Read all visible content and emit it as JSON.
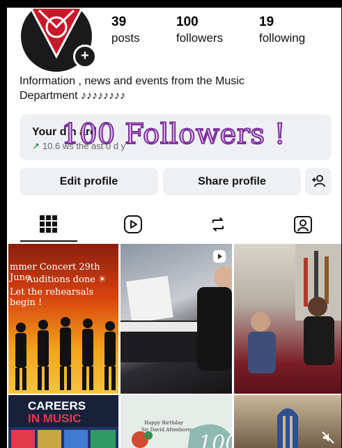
{
  "profile": {
    "stats": [
      {
        "value": "39",
        "label": "posts"
      },
      {
        "value": "100",
        "label": "followers"
      },
      {
        "value": "19",
        "label": "following"
      }
    ],
    "bio_line1": "Information , news and events from the Music",
    "bio_line2": "Department ♪♪♪♪♪♪♪♪"
  },
  "dashboard": {
    "title": "Your d    h     ard",
    "subtitle": "10.6     ws     the  ast  0 d  y"
  },
  "overlay_text": "100 Followers !",
  "buttons": {
    "edit": "Edit profile",
    "share": "Share profile"
  },
  "tabs": [
    "grid-icon",
    "reels-icon",
    "reposts-icon",
    "tagged-icon"
  ],
  "posts": {
    "p1_line1": "mmer Concert 29th June",
    "p1_line2": "Auditions done ☀",
    "p1_line3": "Let the rehearsals begin !",
    "p4_title1": "CAREERS",
    "p4_title2": "IN MUSIC",
    "p5_line1": "Happy Birthday",
    "p5_line2": "Sir David Attenborough",
    "p5_num": "100"
  },
  "colors": {
    "accent_dashboard": "#1a7f37",
    "overlay_fill": "#e7c4f4",
    "overlay_stroke": "#7b2f9c"
  }
}
